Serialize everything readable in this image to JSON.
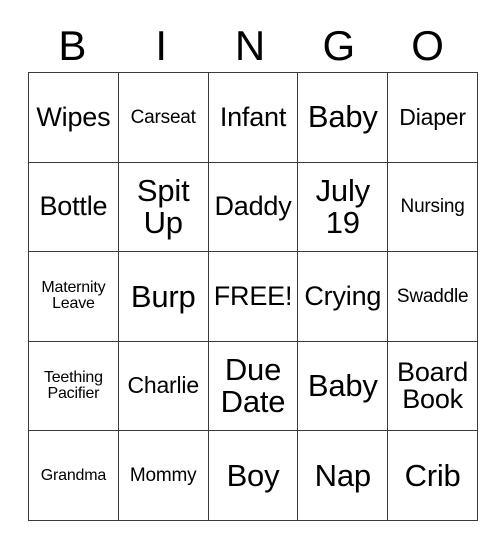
{
  "card": {
    "header": {
      "letters": [
        "B",
        "I",
        "N",
        "G",
        "O"
      ]
    },
    "rows": [
      [
        {
          "text": "Wipes",
          "size": "fs-lg"
        },
        {
          "text": "Carseat",
          "size": "fs-sm"
        },
        {
          "text": "Infant",
          "size": "fs-lg"
        },
        {
          "text": "Baby",
          "size": "fs-xl"
        },
        {
          "text": "Diaper",
          "size": "fs-md"
        }
      ],
      [
        {
          "text": "Bottle",
          "size": "fs-lg"
        },
        {
          "text": "Spit Up",
          "size": "fs-xl"
        },
        {
          "text": "Daddy",
          "size": "fs-lg"
        },
        {
          "text": "July 19",
          "size": "fs-xl"
        },
        {
          "text": "Nursing",
          "size": "fs-sm"
        }
      ],
      [
        {
          "text": "Maternity Leave",
          "size": "fs-xs"
        },
        {
          "text": "Burp",
          "size": "fs-xl"
        },
        {
          "text": "FREE!",
          "size": "fs-lg"
        },
        {
          "text": "Crying",
          "size": "fs-lg"
        },
        {
          "text": "Swaddle",
          "size": "fs-sm"
        }
      ],
      [
        {
          "text": "Teething Pacifier",
          "size": "fs-xs"
        },
        {
          "text": "Charlie",
          "size": "fs-md"
        },
        {
          "text": "Due Date",
          "size": "fs-xl"
        },
        {
          "text": "Baby",
          "size": "fs-xl"
        },
        {
          "text": "Board Book",
          "size": "fs-lg"
        }
      ],
      [
        {
          "text": "Grandma",
          "size": "fs-xs"
        },
        {
          "text": "Mommy",
          "size": "fs-sm"
        },
        {
          "text": "Boy",
          "size": "fs-xl"
        },
        {
          "text": "Nap",
          "size": "fs-xl"
        },
        {
          "text": "Crib",
          "size": "fs-xl"
        }
      ]
    ]
  }
}
